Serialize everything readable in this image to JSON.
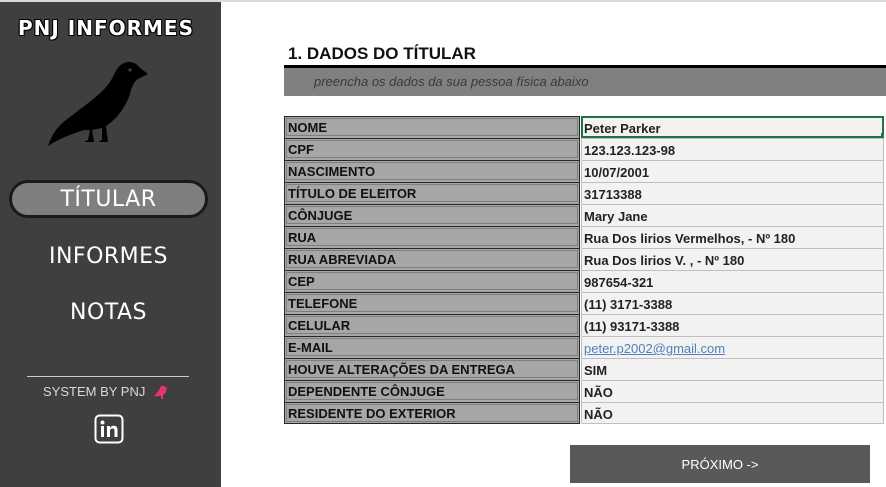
{
  "app": {
    "brand": "PNJ INFORMES"
  },
  "sidebar": {
    "nav": [
      {
        "label": "TÍTULAR",
        "active": true
      },
      {
        "label": "INFORMES",
        "active": false
      },
      {
        "label": "NOTAS",
        "active": false
      }
    ],
    "system_by": "SYSTEM BY PNJ",
    "logo_icon": "bird-silhouette-icon",
    "social_icon": "linkedin-icon"
  },
  "section": {
    "title": "1. DADOS DO TÍTULAR",
    "subtitle": "preencha os dados da sua pessoa física abaixo"
  },
  "form": {
    "rows": [
      {
        "label": "NOME",
        "value": "Peter Parker"
      },
      {
        "label": "CPF",
        "value": "123.123.123-98"
      },
      {
        "label": "NASCIMENTO",
        "value": "10/07/2001"
      },
      {
        "label": "TÍTULO DE ELEITOR",
        "value": "31713388"
      },
      {
        "label": "CÔNJUGE",
        "value": "Mary Jane"
      },
      {
        "label": "RUA",
        "value": "Rua Dos lirios Vermelhos, - Nº 180"
      },
      {
        "label": "RUA ABREVIADA",
        "value": "Rua Dos lirios V. , - Nº 180"
      },
      {
        "label": "CEP",
        "value": "987654-321"
      },
      {
        "label": "TELEFONE",
        "value": "(11) 3171-3388"
      },
      {
        "label": "CELULAR",
        "value": "(11) 93171-3388"
      },
      {
        "label": "E-MAIL",
        "value": "peter.p2002@gmail.com"
      },
      {
        "label": "HOUVE ALTERAÇÕES DA ENTREGA ANTERIOR",
        "value": "SIM"
      },
      {
        "label": "DEPENDENTE CÔNJUGE",
        "value": "NÃO"
      },
      {
        "label": "RESIDENTE DO EXTERIOR",
        "value": "NÃO"
      }
    ]
  },
  "actions": {
    "next_label": "PRÓXIMO ->"
  },
  "colors": {
    "sidebar_bg": "#3f3f3f",
    "label_bg": "#a6a6a6",
    "selection": "#217346",
    "button_bg": "#595959",
    "accent_bird": "#e8336b"
  }
}
